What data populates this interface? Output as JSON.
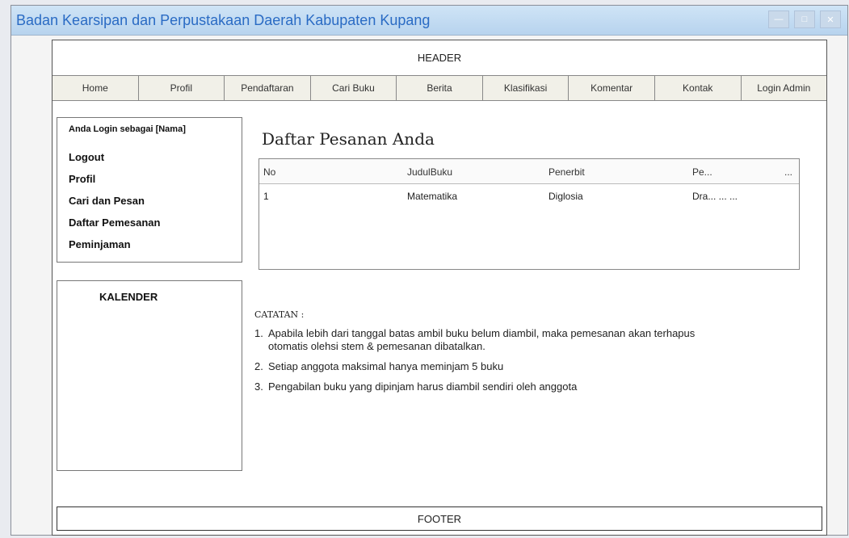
{
  "window": {
    "title": "Badan Kearsipan dan Perpustakaan Daerah Kabupaten Kupang"
  },
  "page": {
    "header": "HEADER",
    "nav": [
      "Home",
      "Profil",
      "Pendaftaran",
      "Cari Buku",
      "Berita",
      "Klasifikasi",
      "Komentar",
      "Kontak",
      "Login Admin"
    ],
    "sidebar": {
      "login_as": "Anda Login sebagai [Nama]",
      "menu": [
        "Logout",
        "Profil",
        "Cari dan Pesan",
        "Daftar Pemesanan",
        "Peminjaman"
      ],
      "calendar_title": "KALENDER"
    },
    "main": {
      "title": "Daftar Pesanan Anda",
      "table": {
        "headers": [
          "No",
          "JudulBuku",
          "Penerbit",
          "Pe...",
          "..."
        ],
        "rows": [
          [
            "1",
            "Matematika",
            "Diglosia",
            "Dra... ... ..."
          ]
        ]
      },
      "notes_title": "CATATAN :",
      "notes": [
        "Apabila lebih dari tanggal batas ambil buku belum diambil, maka pemesanan akan terhapus otomatis olehsi stem & pemesanan dibatalkan.",
        "Setiap anggota maksimal hanya meminjam 5 buku",
        "Pengabilan buku yang dipinjam harus diambil sendiri oleh anggota"
      ]
    },
    "footer": "FOOTER"
  }
}
